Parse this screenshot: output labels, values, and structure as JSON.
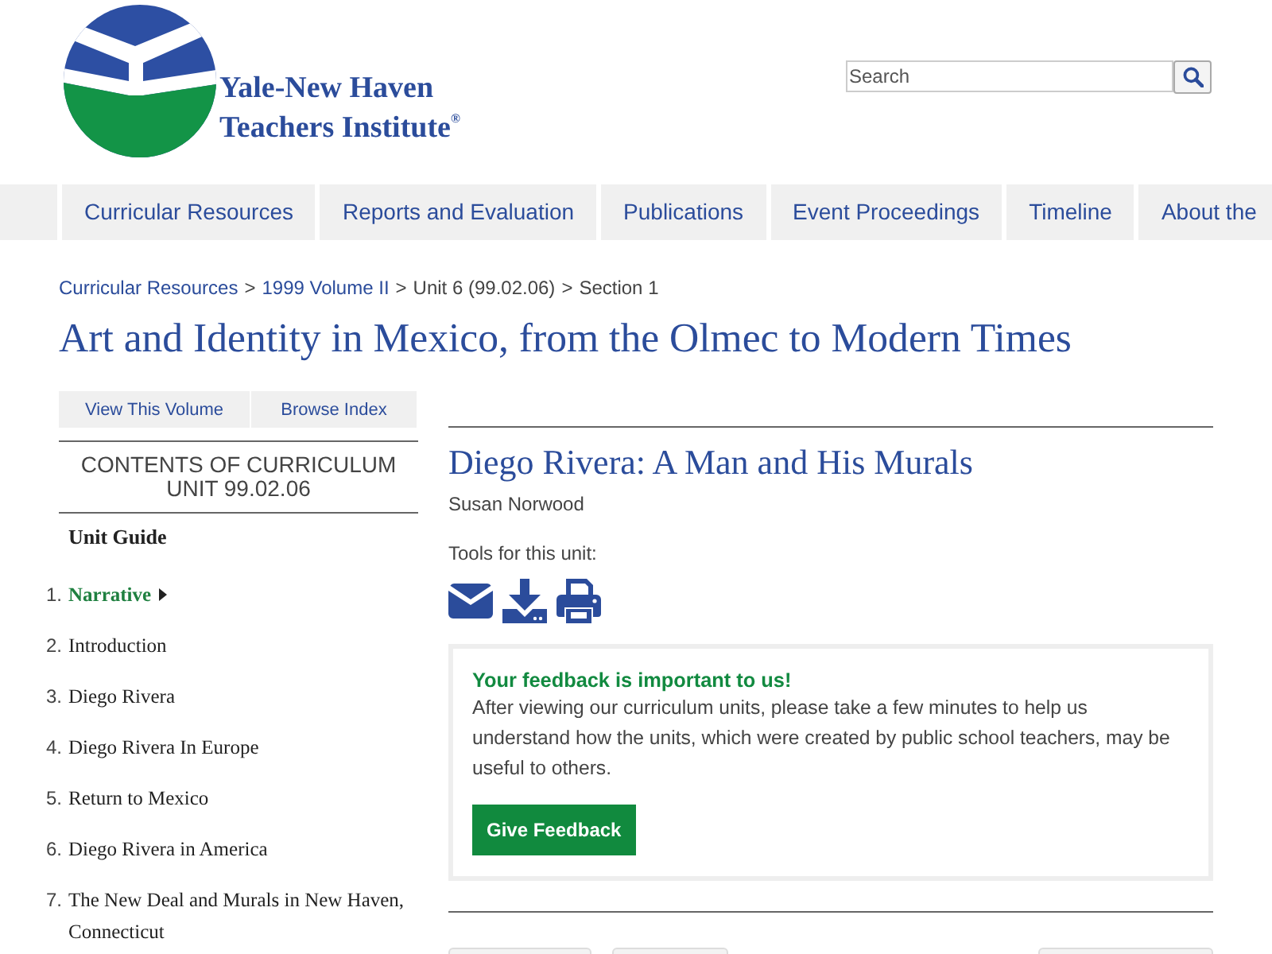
{
  "header": {
    "site_name": [
      "Yale-New Haven",
      "Teachers Institute$^{®}$"
    ],
    "search": {
      "placeholder": "Search"
    }
  },
  "nav": [
    {
      "label": "Curricular Resources"
    },
    {
      "label": "Reports and Evaluation"
    },
    {
      "label": "Publications"
    },
    {
      "label": "Event Proceedings"
    },
    {
      "label": "Timeline"
    },
    {
      "label": "About the"
    }
  ],
  "breadcrumb": {
    "separator": ">",
    "items": [
      {
        "label": "Curricular Resources",
        "kind": "link"
      },
      {
        "label": "1999 Volume II",
        "kind": "link"
      },
      {
        "label": "Unit 6 (99.02.06)",
        "kind": "text"
      },
      {
        "label": "Section 1",
        "kind": "text"
      }
    ]
  },
  "page_title": "Art and Identity in Mexico, from the Olmec to Modern Times",
  "sidebar": {
    "buttons": [
      "View This Volume",
      "Browse Index"
    ],
    "contents_title": "CONTENTS OF CURRICULUM UNIT 99.02.06",
    "guide_label": "Unit Guide",
    "items": [
      {
        "number": "1.",
        "label": "Narrative",
        "selected": true
      },
      {
        "number": "2.",
        "label": "Introduction",
        "selected": false
      },
      {
        "number": "3.",
        "label": "Diego Rivera",
        "selected": false
      },
      {
        "number": "4.",
        "label": "Diego Rivera In Europe",
        "selected": false
      },
      {
        "number": "5.",
        "label": "Return to Mexico",
        "selected": false
      },
      {
        "number": "6.",
        "label": "Diego Rivera in America",
        "selected": false
      },
      {
        "number": "7.",
        "label": "The New Deal and Murals in New Haven, Connecticut",
        "selected": false
      }
    ]
  },
  "unit": {
    "title": "Diego Rivera: A Man and His Murals",
    "author": "Susan Norwood",
    "tools_label": "Tools for this unit:"
  },
  "feedback": {
    "heading": "Your feedback is important to us!",
    "text": "After viewing our curriculum units, please take a few minutes to help us understand how the units, which were created by public school teachers, may be useful to others.",
    "button": "Give Feedback"
  }
}
